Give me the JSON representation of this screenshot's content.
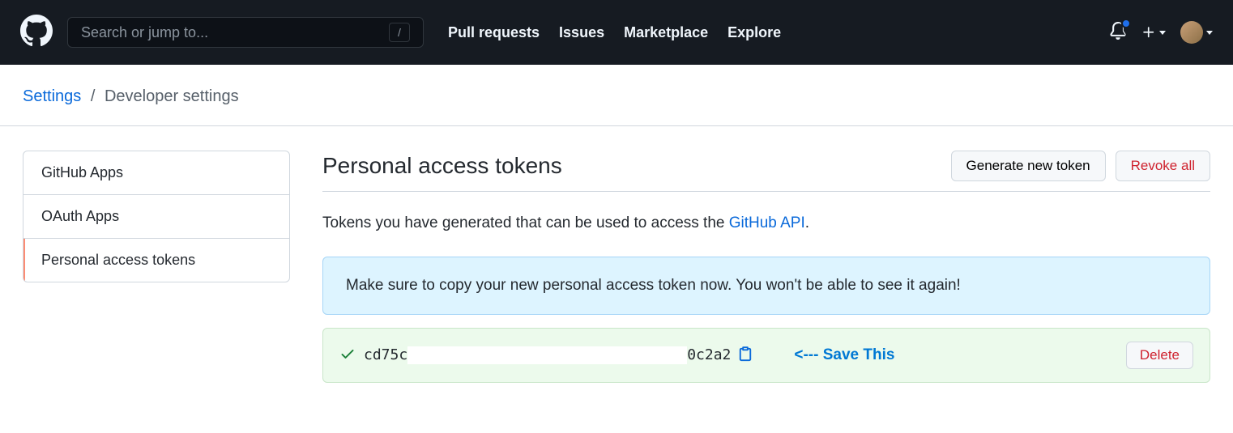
{
  "header": {
    "search_placeholder": "Search or jump to...",
    "nav": [
      "Pull requests",
      "Issues",
      "Marketplace",
      "Explore"
    ]
  },
  "breadcrumb": {
    "parent": "Settings",
    "current": "Developer settings"
  },
  "sidebar": {
    "items": [
      "GitHub Apps",
      "OAuth Apps",
      "Personal access tokens"
    ],
    "active_index": 2
  },
  "main": {
    "title": "Personal access tokens",
    "generate_btn": "Generate new token",
    "revoke_btn": "Revoke all",
    "info_prefix": "Tokens you have generated that can be used to access the ",
    "info_link": "GitHub API",
    "info_suffix": ".",
    "flash_msg": "Make sure to copy your new personal access token now. You won't be able to see it again!",
    "token_prefix": "cd75c",
    "token_suffix": "0c2a2",
    "annotation": "<--- Save This",
    "delete_btn": "Delete"
  }
}
